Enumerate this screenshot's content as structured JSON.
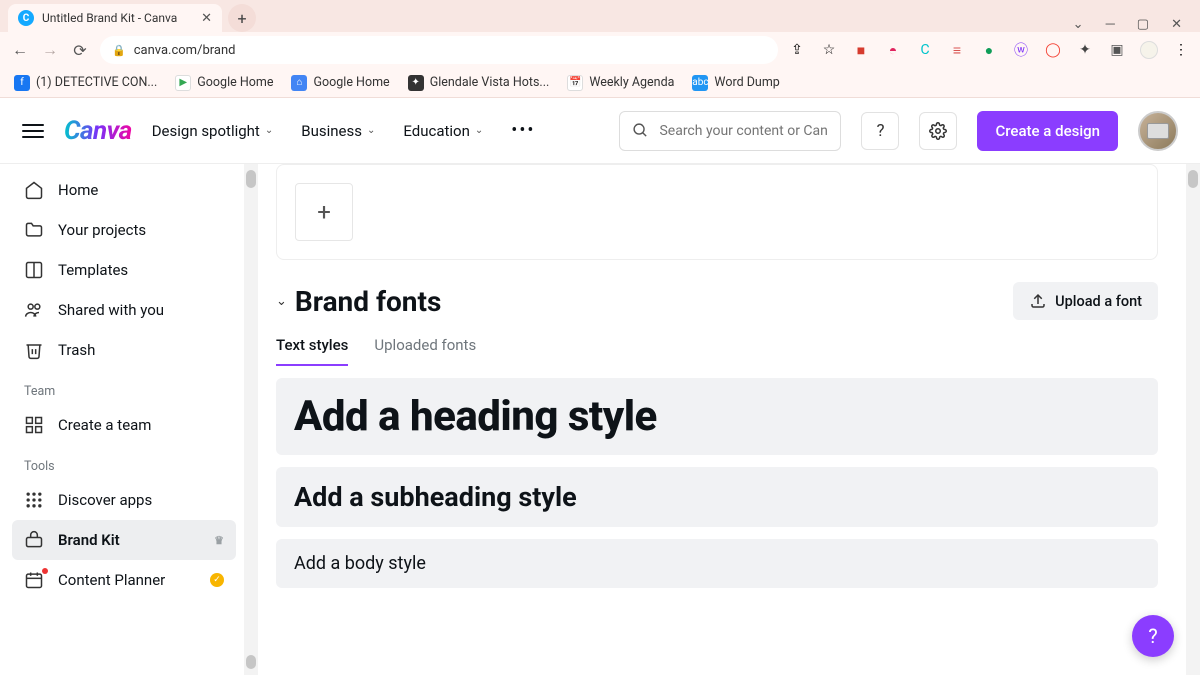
{
  "browser": {
    "tab_title": "Untitled Brand Kit - Canva",
    "url": "canva.com/brand",
    "bookmarks": [
      {
        "label": "(1) DETECTIVE CON...",
        "color": "#1877f2"
      },
      {
        "label": "Google Home",
        "color": "#34a853"
      },
      {
        "label": "Google Home",
        "color": "#4285f4"
      },
      {
        "label": "Glendale Vista Hots...",
        "color": "#333"
      },
      {
        "label": "Weekly Agenda",
        "color": "#e94f3c"
      },
      {
        "label": "Word Dump",
        "color": "#2196f3"
      }
    ]
  },
  "header": {
    "logo": "Canva",
    "menus": [
      "Design spotlight",
      "Business",
      "Education"
    ],
    "search_placeholder": "Search your content or Canva's",
    "create_label": "Create a design"
  },
  "sidebar": {
    "items": [
      {
        "label": "Home",
        "icon": "home"
      },
      {
        "label": "Your projects",
        "icon": "folder"
      },
      {
        "label": "Templates",
        "icon": "templates"
      },
      {
        "label": "Shared with you",
        "icon": "people"
      },
      {
        "label": "Trash",
        "icon": "trash"
      }
    ],
    "team_header": "Team",
    "team_item": "Create a team",
    "tools_header": "Tools",
    "tools": [
      {
        "label": "Discover apps",
        "icon": "apps"
      },
      {
        "label": "Brand Kit",
        "icon": "brandkit",
        "active": true
      },
      {
        "label": "Content Planner",
        "icon": "calendar",
        "badge": true
      }
    ]
  },
  "main": {
    "section_title": "Brand fonts",
    "upload_label": "Upload a font",
    "tabs": [
      "Text styles",
      "Uploaded fonts"
    ],
    "active_tab": 0,
    "styles": [
      {
        "text": "Add a heading style",
        "class": "sc-h1"
      },
      {
        "text": "Add a subheading style",
        "class": "sc-h2"
      },
      {
        "text": "Add a body style",
        "class": "sc-body"
      }
    ],
    "fab": "?"
  }
}
